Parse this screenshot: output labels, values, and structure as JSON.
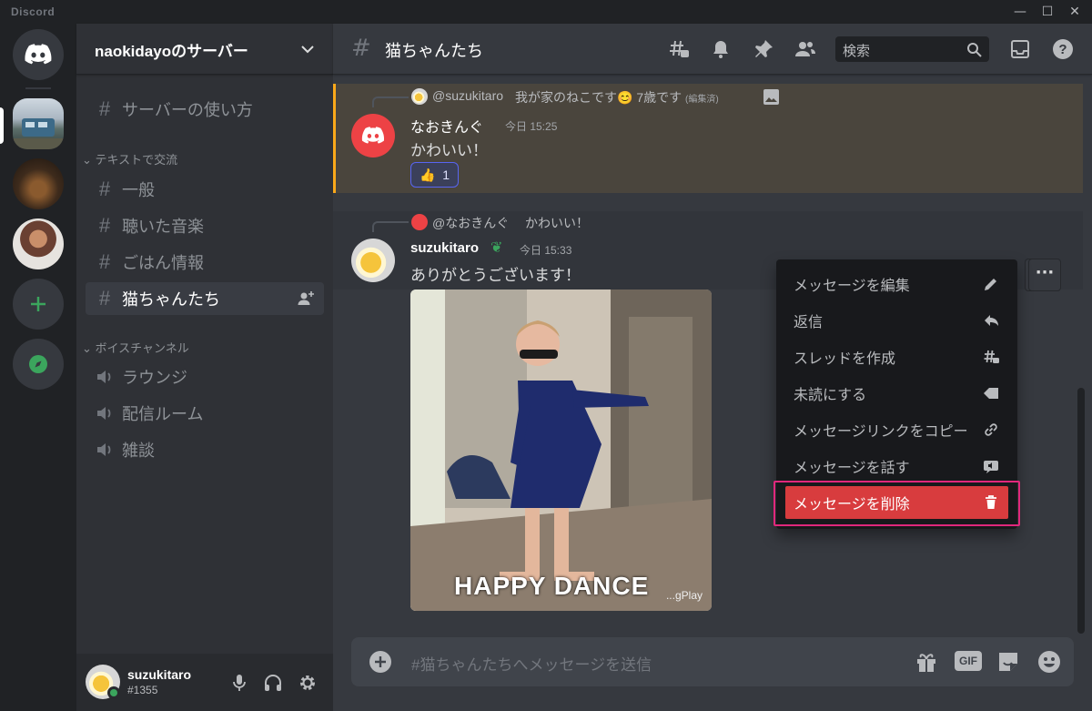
{
  "app": {
    "brand": "Discord"
  },
  "server": {
    "name": "naokidayoのサーバー",
    "top_channel": "サーバーの使い方",
    "text_category": "テキストで交流",
    "text_channels": [
      "一般",
      "聴いた音楽",
      "ごはん情報",
      "猫ちゃんたち"
    ],
    "voice_category": "ボイスチャンネル",
    "voice_channels": [
      "ラウンジ",
      "配信ルーム",
      "雑談"
    ]
  },
  "user": {
    "name": "suzukitaro",
    "tag": "#1355"
  },
  "channel": {
    "name": "猫ちゃんたち"
  },
  "search": {
    "placeholder": "検索"
  },
  "messages": [
    {
      "reply_to_name": "@suzukitaro",
      "reply_to_text": "我が家のねこです😊 7歳です",
      "reply_edited": "(編集済)",
      "author": "なおきんぐ",
      "time": "今日 15:25",
      "text": "かわいい！",
      "reaction_emoji": "👍",
      "reaction_count": "1"
    },
    {
      "reply_to_name": "@なおきんぐ",
      "reply_to_text": "かわいい！",
      "author": "suzukitaro",
      "time": "今日 15:33",
      "text": "ありがとうございます！",
      "gif_caption": "HAPPY DANCE",
      "gif_watermark": "...gPlay"
    }
  ],
  "context_menu": {
    "items": [
      {
        "label": "メッセージを編集",
        "icon": "pencil-icon"
      },
      {
        "label": "返信",
        "icon": "reply-icon"
      },
      {
        "label": "スレッドを作成",
        "icon": "threads-icon"
      },
      {
        "label": "未読にする",
        "icon": "mark-unread-icon"
      },
      {
        "label": "メッセージリンクをコピー",
        "icon": "link-icon"
      },
      {
        "label": "メッセージを話す",
        "icon": "speak-icon"
      },
      {
        "label": "メッセージを削除",
        "icon": "trash-icon"
      }
    ]
  },
  "composer": {
    "placeholder": "#猫ちゃんたちへメッセージを送信",
    "gif_label": "GIF"
  },
  "colors": {
    "accent": "#5865f2",
    "danger": "#d83c3e",
    "online": "#3ba55d",
    "mention_highlight": "#faa81a"
  }
}
